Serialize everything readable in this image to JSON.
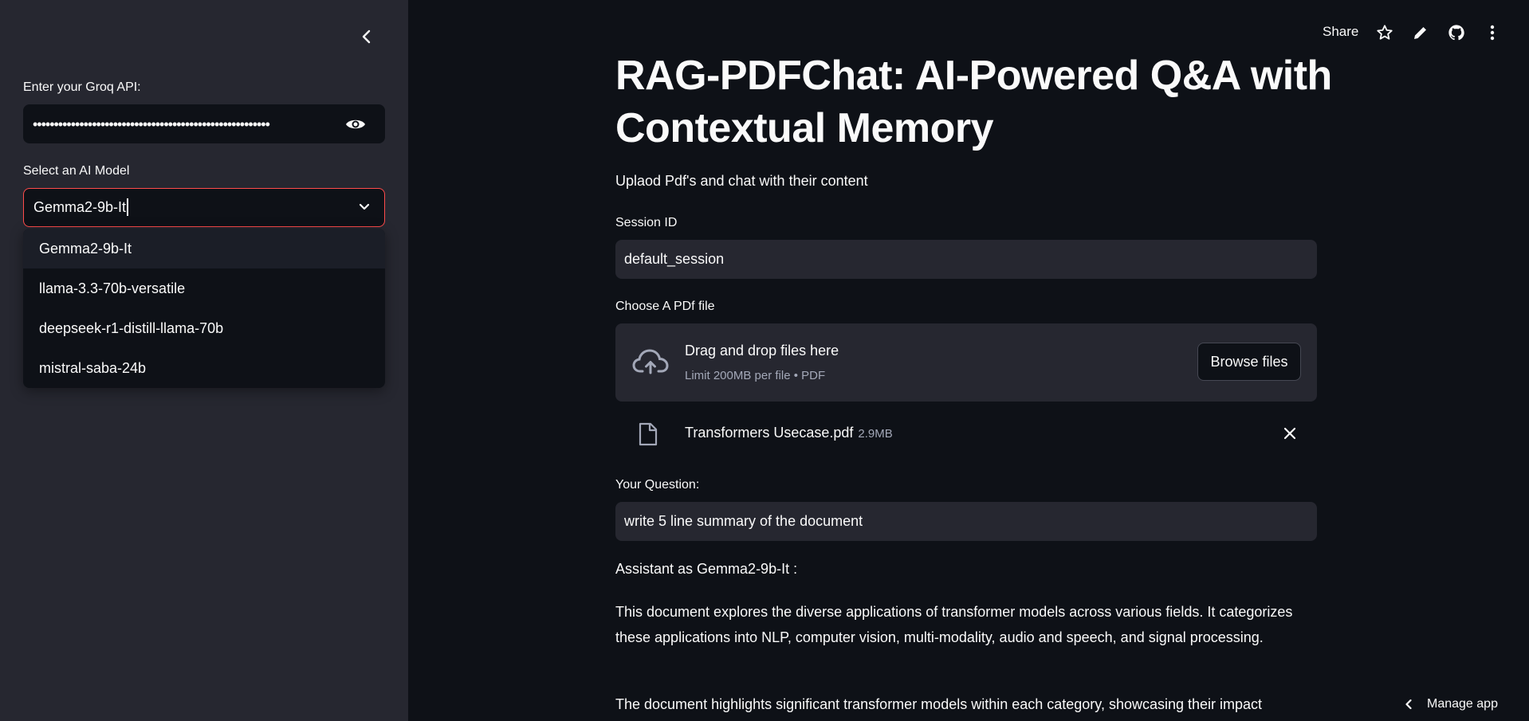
{
  "header": {
    "share_label": "Share",
    "icons": [
      "star-icon",
      "pencil-icon",
      "github-icon",
      "more-vert-icon"
    ]
  },
  "sidebar": {
    "api_label": "Enter your Groq API:",
    "api_value": "••••••••••••••••••••••••••••••••••••••••••••••••••••••••",
    "model_label": "Select an AI Model",
    "model_selected": "Gemma2-9b-It",
    "model_options": [
      "Gemma2-9b-It",
      "llama-3.3-70b-versatile",
      "deepseek-r1-distill-llama-70b",
      "mistral-saba-24b"
    ]
  },
  "main": {
    "title": "RAG-PDFChat: AI-Powered Q&A with Contextual Memory",
    "subtitle": "Uplaod Pdf's and chat with their content",
    "session_label": "Session ID",
    "session_value": "default_session",
    "uploader_label": "Choose A PDf file",
    "dropzone_title": "Drag and drop files here",
    "dropzone_limit": "Limit 200MB per file • PDF",
    "browse_label": "Browse files",
    "file_name": "Transformers Usecase.pdf",
    "file_size": "2.9MB",
    "question_label": "Your Question:",
    "question_value": "write 5 line summary of the document",
    "assistant_label": "Assistant as Gemma2-9b-It :",
    "answer_paragraphs": [
      "This document explores the diverse applications of transformer models across various fields. It categorizes these applications into NLP, computer vision, multi-modality, audio and speech, and signal processing.",
      "The document highlights significant transformer models within each category, showcasing their impact"
    ]
  },
  "footer": {
    "manage_label": "Manage app"
  },
  "colors": {
    "accent": "#ff4b4b",
    "bg": "#0e1117",
    "sidebar": "#262730"
  }
}
